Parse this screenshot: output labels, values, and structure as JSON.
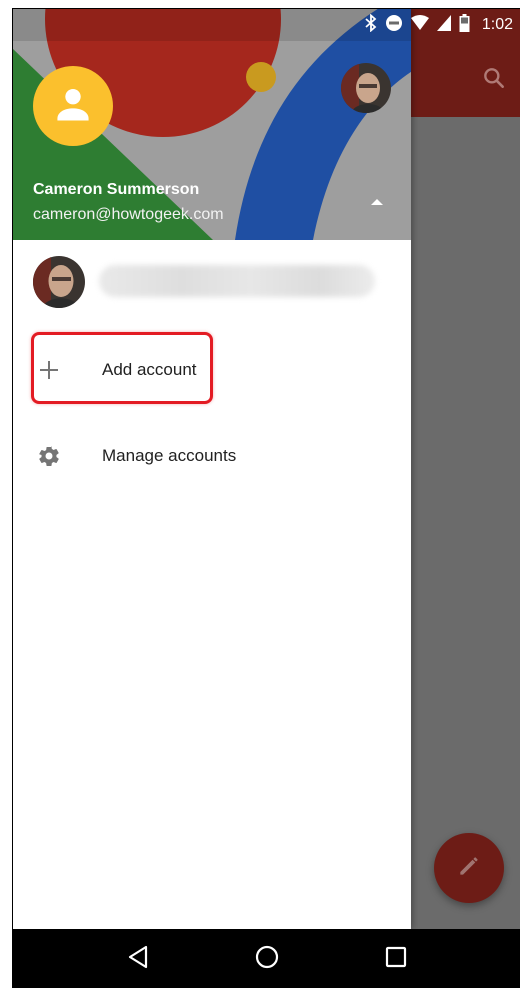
{
  "status_bar": {
    "time": "1:02",
    "icons": [
      "bluetooth-icon",
      "do-not-disturb-icon",
      "wifi-icon",
      "signal-icon",
      "battery-icon"
    ]
  },
  "drawer": {
    "account": {
      "name": "Cameron Summerson",
      "email": "cameron@howtogeek.com"
    },
    "menu": {
      "add_account": "Add account",
      "manage_accounts": "Manage accounts"
    }
  },
  "colors": {
    "app_toolbar": "#6d1c16",
    "avatar_yellow": "#fbc02d",
    "header_green": "#2e7d32",
    "header_red": "#a5271d",
    "header_blue": "#1f4fa3",
    "highlight_red": "#e31b23"
  },
  "nav": {
    "icons": [
      "back-icon",
      "home-icon",
      "recents-icon"
    ]
  }
}
